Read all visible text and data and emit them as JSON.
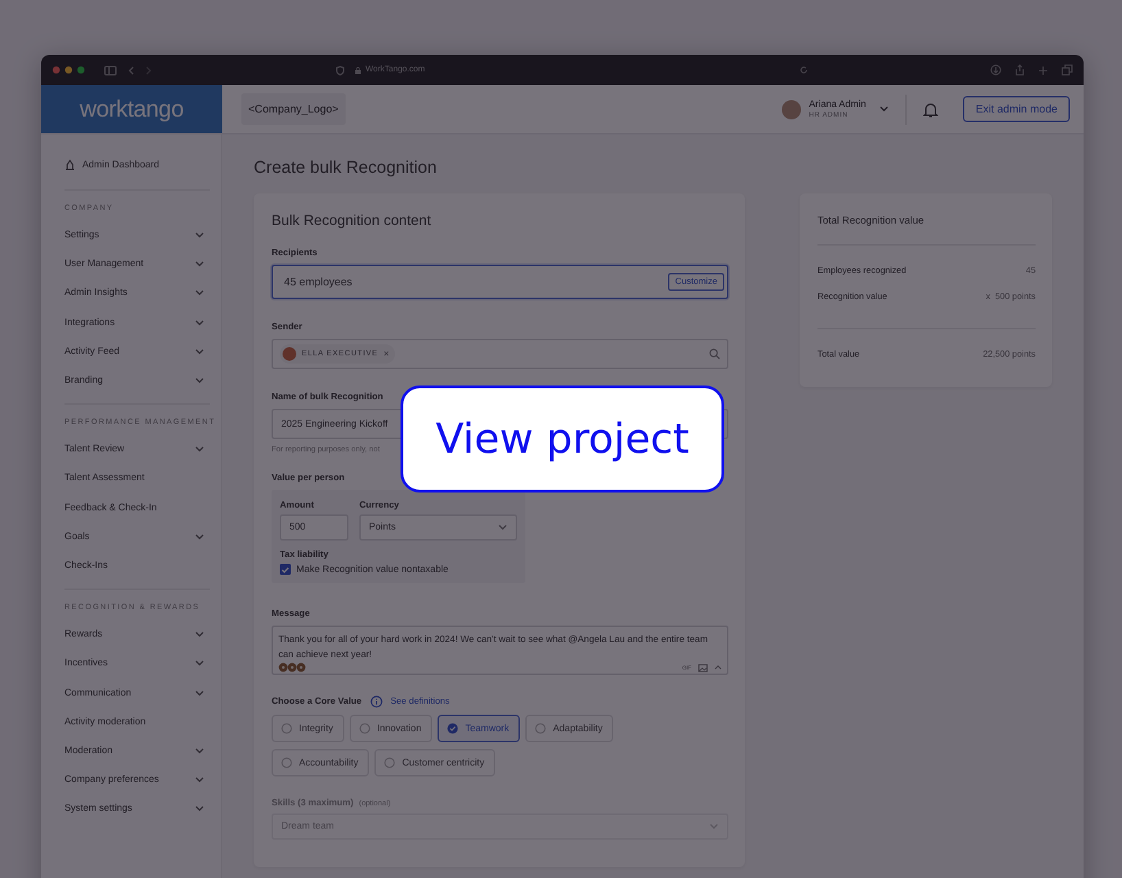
{
  "browser": {
    "url": "WorkTango.com"
  },
  "header": {
    "logo": "worktango",
    "company_logo": "<Company_Logo>",
    "user_name": "Ariana Admin",
    "user_role": "HR ADMIN",
    "exit_button": "Exit admin mode"
  },
  "sidebar": {
    "top_item": "Admin Dashboard",
    "sections": [
      {
        "heading": "COMPANY",
        "items": [
          {
            "label": "Settings",
            "has_submenu": true
          },
          {
            "label": "User Management",
            "has_submenu": true
          },
          {
            "label": "Admin Insights",
            "has_submenu": true
          },
          {
            "label": "Integrations",
            "has_submenu": true
          },
          {
            "label": "Activity Feed",
            "has_submenu": true
          },
          {
            "label": "Branding",
            "has_submenu": true
          }
        ]
      },
      {
        "heading": "PERFORMANCE MANAGEMENT",
        "items": [
          {
            "label": "Talent Review",
            "has_submenu": true
          },
          {
            "label": "Talent Assessment",
            "has_submenu": false
          },
          {
            "label": "Feedback & Check-In",
            "has_submenu": false
          },
          {
            "label": "Goals",
            "has_submenu": true
          },
          {
            "label": "Check-Ins",
            "has_submenu": false
          }
        ]
      },
      {
        "heading": "RECOGNITION & REWARDS",
        "items": [
          {
            "label": "Rewards",
            "has_submenu": true
          },
          {
            "label": "Incentives",
            "has_submenu": true
          },
          {
            "label": "Communication",
            "has_submenu": true
          },
          {
            "label": "Activity moderation",
            "has_submenu": false
          },
          {
            "label": "Moderation",
            "has_submenu": true
          },
          {
            "label": "Company preferences",
            "has_submenu": true
          },
          {
            "label": "System settings",
            "has_submenu": true
          }
        ]
      }
    ]
  },
  "page_title": "Create bulk Recognition",
  "form": {
    "title": "Bulk Recognition content",
    "recipients": {
      "label": "Recipients",
      "value": "45 employees",
      "button": "Customize"
    },
    "sender": {
      "label": "Sender",
      "chip": "ELLA EXECUTIVE",
      "chip_remove": "×"
    },
    "name": {
      "label": "Name of bulk Recognition",
      "value": "2025 Engineering Kickoff",
      "hint": "For reporting purposes only, not"
    },
    "value_per_person": {
      "label": "Value per person",
      "amount_label": "Amount",
      "amount": "500",
      "currency_label": "Currency",
      "currency": "Points",
      "tax_label": "Tax liability",
      "nontaxable": {
        "label": "Make Recognition value nontaxable",
        "checked": true
      }
    },
    "message": {
      "label": "Message",
      "value": "Thank you for all of your hard work in 2024! We can't wait to see what @Angela Lau and the entire team can achieve next year!",
      "gif": "GIF"
    },
    "core_value": {
      "label": "Choose a Core Value",
      "link": "See definitions",
      "options": [
        {
          "label": "Integrity",
          "selected": false
        },
        {
          "label": "Innovation",
          "selected": false
        },
        {
          "label": "Teamwork",
          "selected": true
        },
        {
          "label": "Adaptability",
          "selected": false
        },
        {
          "label": "Accountability",
          "selected": false
        },
        {
          "label": "Customer centricity",
          "selected": false
        }
      ]
    },
    "skills": {
      "label": "Skills (3 maximum)",
      "optional": "(optional)",
      "placeholder": "Dream team"
    }
  },
  "summary": {
    "title": "Total Recognition value",
    "rows": [
      {
        "label": "Employees recognized",
        "value": "45"
      },
      {
        "label": "Recognition value",
        "value": "x  500 points"
      }
    ],
    "total_label": "Total value",
    "total_value": "22,500 points"
  },
  "overlay_button": "View project"
}
